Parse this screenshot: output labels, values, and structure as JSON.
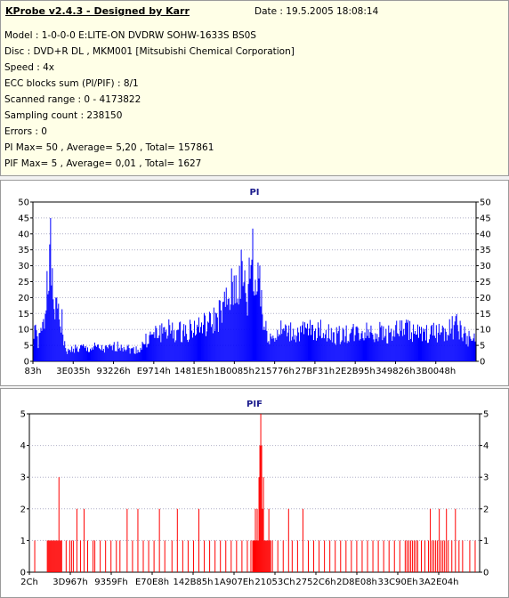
{
  "info": {
    "title": "KProbe v2.4.3 - Designed by Karr",
    "date": "Date : 19.5.2005 18:08:14",
    "lines": [
      "Model : 1-0-0-0 E:LITE-ON DVDRW SOHW-1633S BS0S",
      "Disc : DVD+R DL , MKM001 [Mitsubishi Chemical Corporation]",
      "Speed : 4x",
      "ECC blocks sum (PI/PIF) : 8/1",
      "Scanned range : 0 - 4173822",
      "Sampling count : 238150",
      "Errors : 0",
      "PI Max= 50 , Average= 5,20 , Total= 157861",
      "PIF Max= 5 , Average= 0,01 , Total= 1627"
    ]
  },
  "colors": {
    "pi": "#0000ff",
    "pif": "#ff0000",
    "title": "#1a1a8c",
    "grid": "#b0b0c8"
  },
  "chart_data": [
    {
      "type": "bar",
      "title": "PI",
      "ylim": [
        0,
        50
      ],
      "yticks": [
        0,
        5,
        10,
        15,
        20,
        25,
        30,
        35,
        40,
        45,
        50
      ],
      "xticklabels": [
        "83h",
        "3E035h",
        "93226h",
        "E9714h",
        "1481E5h",
        "1B0085h",
        "215776h",
        "27BF31h",
        "2E2B95h",
        "349826h",
        "3B0048h"
      ],
      "grid": true,
      "envelope": [
        [
          0,
          12
        ],
        [
          2,
          18
        ],
        [
          3,
          10
        ],
        [
          5,
          8
        ],
        [
          8,
          12
        ],
        [
          10,
          14
        ],
        [
          12,
          18
        ],
        [
          14,
          26
        ],
        [
          15,
          42
        ],
        [
          16,
          46
        ],
        [
          17,
          48
        ],
        [
          18,
          50
        ],
        [
          19,
          45
        ],
        [
          20,
          40
        ],
        [
          21,
          30
        ],
        [
          22,
          22
        ],
        [
          24,
          25
        ],
        [
          26,
          20
        ],
        [
          28,
          26
        ],
        [
          30,
          16
        ],
        [
          32,
          18
        ],
        [
          34,
          8
        ],
        [
          36,
          5
        ],
        [
          40,
          4
        ],
        [
          45,
          6
        ],
        [
          50,
          5
        ],
        [
          55,
          6
        ],
        [
          60,
          5
        ],
        [
          70,
          6
        ],
        [
          80,
          5
        ],
        [
          90,
          6
        ],
        [
          100,
          7
        ],
        [
          105,
          6
        ],
        [
          110,
          5
        ],
        [
          120,
          5
        ],
        [
          125,
          8
        ],
        [
          130,
          10
        ],
        [
          140,
          12
        ],
        [
          150,
          14
        ],
        [
          160,
          12
        ],
        [
          170,
          13
        ],
        [
          180,
          14
        ],
        [
          190,
          15
        ],
        [
          200,
          16
        ],
        [
          210,
          20
        ],
        [
          215,
          22
        ],
        [
          220,
          26
        ],
        [
          225,
          30
        ],
        [
          230,
          33
        ],
        [
          235,
          36
        ],
        [
          240,
          30
        ],
        [
          242,
          25
        ],
        [
          246,
          44
        ],
        [
          248,
          49
        ],
        [
          250,
          30
        ],
        [
          252,
          32
        ],
        [
          254,
          38
        ],
        [
          256,
          41
        ],
        [
          258,
          28
        ],
        [
          260,
          15
        ],
        [
          265,
          12
        ],
        [
          270,
          10
        ],
        [
          280,
          13
        ],
        [
          300,
          12
        ],
        [
          320,
          14
        ],
        [
          340,
          11
        ],
        [
          360,
          12
        ],
        [
          380,
          13
        ],
        [
          400,
          12
        ],
        [
          420,
          14
        ],
        [
          440,
          11
        ],
        [
          460,
          13
        ],
        [
          480,
          15
        ],
        [
          490,
          10
        ],
        [
          500,
          9
        ]
      ]
    },
    {
      "type": "bar",
      "title": "PIF",
      "ylim": [
        0,
        5
      ],
      "yticks": [
        0,
        1,
        2,
        3,
        4,
        5
      ],
      "xticklabels": [
        "2Ch",
        "3D967h",
        "9359Fh",
        "E70E8h",
        "142B85h",
        "1A907Eh",
        "21053Ch",
        "2752C6h",
        "2D8E08h",
        "33C90Eh",
        "3A2E04h"
      ],
      "grid": true,
      "spikes": [
        [
          5,
          1
        ],
        [
          19,
          1
        ],
        [
          20,
          1
        ],
        [
          21,
          1
        ],
        [
          22,
          1
        ],
        [
          23,
          1
        ],
        [
          24,
          1
        ],
        [
          25,
          1
        ],
        [
          26,
          1
        ],
        [
          27,
          1
        ],
        [
          28,
          1
        ],
        [
          29,
          1
        ],
        [
          30,
          1
        ],
        [
          31,
          1
        ],
        [
          32,
          3
        ],
        [
          33,
          1
        ],
        [
          34,
          1
        ],
        [
          35,
          1
        ],
        [
          40,
          1
        ],
        [
          44,
          1
        ],
        [
          46,
          1
        ],
        [
          48,
          1
        ],
        [
          52,
          2
        ],
        [
          56,
          1
        ],
        [
          60,
          2
        ],
        [
          64,
          1
        ],
        [
          70,
          1
        ],
        [
          72,
          1
        ],
        [
          78,
          1
        ],
        [
          84,
          1
        ],
        [
          90,
          1
        ],
        [
          96,
          1
        ],
        [
          100,
          1
        ],
        [
          108,
          2
        ],
        [
          114,
          1
        ],
        [
          120,
          2
        ],
        [
          126,
          1
        ],
        [
          132,
          1
        ],
        [
          138,
          1
        ],
        [
          144,
          2
        ],
        [
          150,
          1
        ],
        [
          158,
          1
        ],
        [
          164,
          2
        ],
        [
          170,
          1
        ],
        [
          176,
          1
        ],
        [
          182,
          1
        ],
        [
          188,
          2
        ],
        [
          194,
          1
        ],
        [
          200,
          1
        ],
        [
          206,
          1
        ],
        [
          212,
          1
        ],
        [
          218,
          1
        ],
        [
          224,
          1
        ],
        [
          230,
          1
        ],
        [
          236,
          1
        ],
        [
          242,
          1
        ],
        [
          246,
          1
        ],
        [
          248,
          1
        ],
        [
          249,
          1
        ],
        [
          250,
          1
        ],
        [
          251,
          2
        ],
        [
          252,
          1
        ],
        [
          253,
          2
        ],
        [
          254,
          1
        ],
        [
          255,
          3
        ],
        [
          256,
          4
        ],
        [
          257,
          5
        ],
        [
          258,
          4
        ],
        [
          259,
          2
        ],
        [
          260,
          3
        ],
        [
          261,
          1
        ],
        [
          262,
          1
        ],
        [
          263,
          1
        ],
        [
          264,
          1
        ],
        [
          265,
          1
        ],
        [
          266,
          2
        ],
        [
          267,
          1
        ],
        [
          268,
          1
        ],
        [
          270,
          1
        ],
        [
          276,
          1
        ],
        [
          282,
          1
        ],
        [
          288,
          2
        ],
        [
          292,
          1
        ],
        [
          298,
          1
        ],
        [
          304,
          2
        ],
        [
          310,
          1
        ],
        [
          316,
          1
        ],
        [
          322,
          1
        ],
        [
          328,
          1
        ],
        [
          334,
          1
        ],
        [
          340,
          1
        ],
        [
          346,
          1
        ],
        [
          352,
          1
        ],
        [
          358,
          1
        ],
        [
          364,
          1
        ],
        [
          370,
          1
        ],
        [
          376,
          1
        ],
        [
          382,
          1
        ],
        [
          388,
          1
        ],
        [
          394,
          1
        ],
        [
          400,
          1
        ],
        [
          406,
          1
        ],
        [
          412,
          1
        ],
        [
          418,
          1
        ],
        [
          420,
          1
        ],
        [
          422,
          1
        ],
        [
          424,
          1
        ],
        [
          426,
          1
        ],
        [
          428,
          1
        ],
        [
          430,
          1
        ],
        [
          432,
          1
        ],
        [
          436,
          1
        ],
        [
          440,
          1
        ],
        [
          444,
          1
        ],
        [
          446,
          2
        ],
        [
          448,
          1
        ],
        [
          450,
          1
        ],
        [
          452,
          1
        ],
        [
          454,
          1
        ],
        [
          456,
          2
        ],
        [
          458,
          1
        ],
        [
          460,
          1
        ],
        [
          462,
          1
        ],
        [
          464,
          2
        ],
        [
          466,
          1
        ],
        [
          470,
          1
        ],
        [
          474,
          2
        ],
        [
          478,
          1
        ],
        [
          482,
          1
        ],
        [
          490,
          1
        ],
        [
          496,
          1
        ]
      ]
    }
  ]
}
